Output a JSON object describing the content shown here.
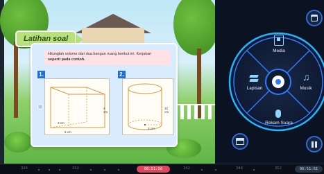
{
  "lesson": {
    "banner": "Latihan soal",
    "instruction_line1": "Hitunglah volume dari dua bangun ruang berikut ini. Kerjakan",
    "instruction_line2": "seperti pada contoh.",
    "questions": [
      {
        "number": "1.",
        "shape": "triangular-prism",
        "dims": [
          "4 cm",
          "3 cm",
          "5 cm"
        ]
      },
      {
        "number": "2.",
        "shape": "cylinder",
        "dims": [
          "10 cm",
          "3 cm"
        ]
      }
    ]
  },
  "panel": {
    "menu": [
      {
        "label": "Media",
        "icon": "media-icon"
      },
      {
        "label": "Lapisan",
        "icon": "layers-icon"
      },
      {
        "label": "Musik",
        "icon": "music-icon"
      },
      {
        "label": "Rekam Suara",
        "icon": "microphone-icon"
      }
    ],
    "accent": "#2f7bff",
    "glow": "#1fb6ff"
  },
  "timeline": {
    "ticks": [
      "326",
      "332",
      "342",
      "348",
      "352"
    ],
    "current": "00:51:56",
    "end": "00:51:61"
  }
}
